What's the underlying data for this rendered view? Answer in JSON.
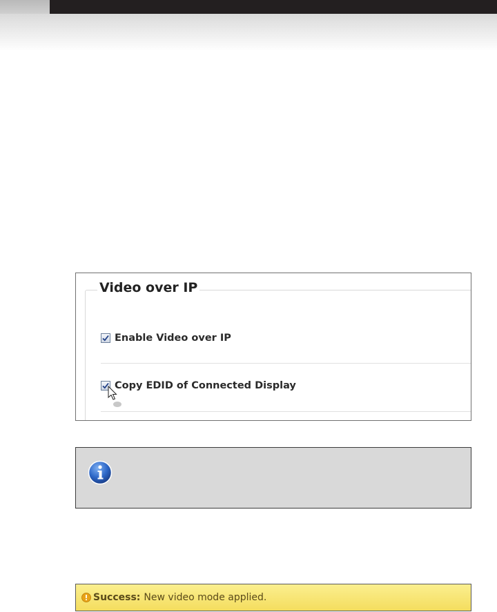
{
  "section": {
    "title": "Video over IP"
  },
  "options": [
    {
      "label": "Enable Video over IP",
      "checked": true
    },
    {
      "label": "Copy EDID of Connected Display",
      "checked": true
    }
  ],
  "info": {
    "icon": "info-icon"
  },
  "status": {
    "icon": "warning-icon",
    "label": "Success:",
    "message": "New video mode applied.",
    "background_color": "#f6e471"
  },
  "colors": {
    "header_bar": "#231f20",
    "info_box": "#d9d9d9"
  }
}
